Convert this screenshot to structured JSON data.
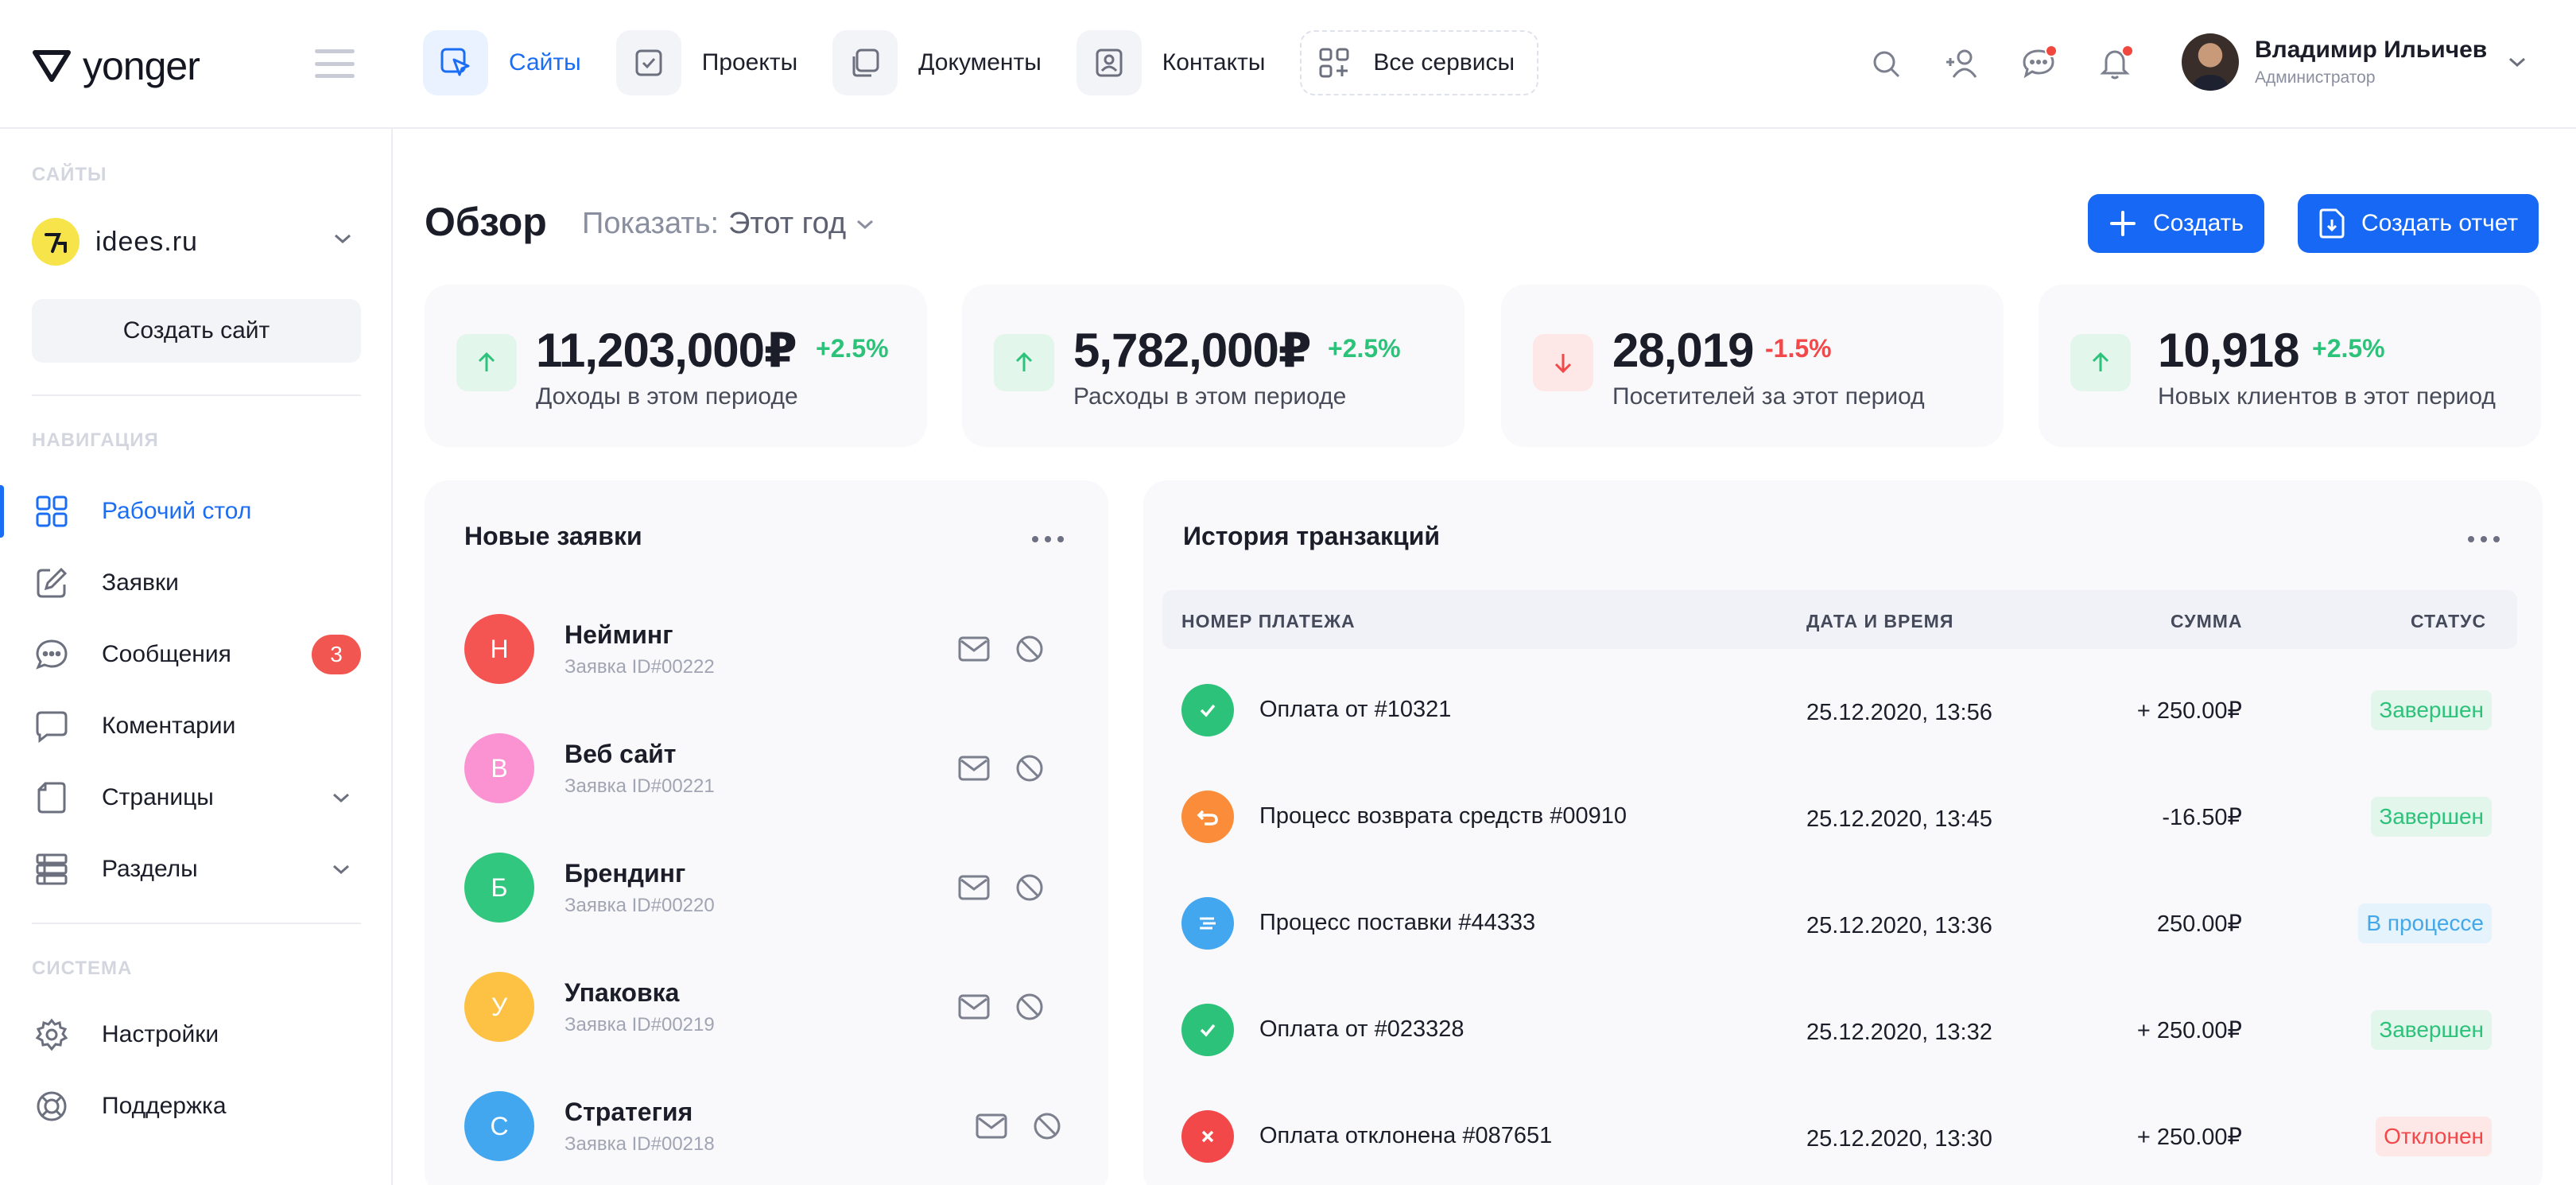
{
  "brand": {
    "name": "yonger"
  },
  "topnav": [
    {
      "label": "Сайты",
      "icon": "cursor-icon",
      "active": true
    },
    {
      "label": "Проекты",
      "icon": "checkbox-icon"
    },
    {
      "label": "Документы",
      "icon": "documents-icon"
    },
    {
      "label": "Контакты",
      "icon": "contact-card-icon"
    },
    {
      "label": "Все сервисы",
      "icon": "grid-plus-icon"
    }
  ],
  "user": {
    "name": "Владимир Ильичев",
    "role": "Администратор"
  },
  "sidebar": {
    "sites_title": "САЙТЫ",
    "site_name": "idees.ru",
    "create_site": "Создать сайт",
    "nav_title": "НАВИГАЦИЯ",
    "nav": [
      {
        "label": "Рабочий стол",
        "icon": "dashboard-icon",
        "active": true
      },
      {
        "label": "Заявки",
        "icon": "edit-icon"
      },
      {
        "label": "Сообщения",
        "icon": "chat-dots-icon",
        "badge": "3"
      },
      {
        "label": "Коментарии",
        "icon": "comment-icon"
      },
      {
        "label": "Страницы",
        "icon": "page-icon",
        "expandable": true
      },
      {
        "label": "Разделы",
        "icon": "sections-icon",
        "expandable": true
      }
    ],
    "system_title": "СИСТЕМА",
    "system": [
      {
        "label": "Настройки",
        "icon": "gear-icon"
      },
      {
        "label": "Поддержка",
        "icon": "lifebuoy-icon"
      }
    ]
  },
  "overview": {
    "title": "Обзор",
    "show_label": "Показать:",
    "show_value": "Этот год",
    "create_button": "Создать",
    "report_button": "Создать отчет"
  },
  "stats": [
    {
      "value": "11,203,000₽",
      "change": "+2.5%",
      "label": "Доходы в этом периоде",
      "trend": "up"
    },
    {
      "value": "5,782,000₽",
      "change": "+2.5%",
      "label": "Расходы в этом периоде",
      "trend": "up"
    },
    {
      "value": "28,019",
      "change": "-1.5%",
      "label": "Посетителей за этот период",
      "trend": "down"
    },
    {
      "value": "10,918",
      "change": "+2.5%",
      "label": "Новых клиентов в этот период",
      "trend": "up"
    }
  ],
  "requests": {
    "title": "Новые заявки",
    "items": [
      {
        "initial": "Н",
        "title": "Нейминг",
        "id": "Заявка ID#00222",
        "color": "#f55552"
      },
      {
        "initial": "В",
        "title": "Веб сайт",
        "id": "Заявка ID#00221",
        "color": "#fb93d3"
      },
      {
        "initial": "Б",
        "title": "Брендинг",
        "id": "Заявка ID#00220",
        "color": "#31c77e"
      },
      {
        "initial": "У",
        "title": "Упаковка",
        "id": "Заявка ID#00219",
        "color": "#fdc143"
      },
      {
        "initial": "С",
        "title": "Стратегия",
        "id": "Заявка ID#00218",
        "color": "#43a7f0"
      }
    ]
  },
  "transactions": {
    "title": "История транзакций",
    "headers": {
      "number": "НОМЕР ПЛАТЕЖА",
      "date": "ДАТА И ВРЕМЯ",
      "sum": "СУММА",
      "status": "СТАТУС"
    },
    "rows": [
      {
        "name": "Оплата от #10321",
        "date": "25.12.2020, 13:56",
        "sum": "+ 250.00₽",
        "status": "Завершен",
        "kind": "ok"
      },
      {
        "name": "Процесс возврата средств #00910",
        "date": "25.12.2020, 13:45",
        "sum": "-16.50₽",
        "status": "Завершен",
        "kind": "refund"
      },
      {
        "name": "Процесс поставки #44333",
        "date": "25.12.2020, 13:36",
        "sum": "250.00₽",
        "status": "В процессе",
        "kind": "delivery"
      },
      {
        "name": "Оплата от #023328",
        "date": "25.12.2020, 13:32",
        "sum": "+ 250.00₽",
        "status": "Завершен",
        "kind": "ok"
      },
      {
        "name": "Оплата отклонена #087651",
        "date": "25.12.2020, 13:30",
        "sum": "+ 250.00₽",
        "status": "Отклонен",
        "kind": "rejected"
      }
    ]
  },
  "colors": {
    "accent": "#1668f5",
    "success": "#2dc27a",
    "danger": "#f2484a",
    "info": "#43a7e8"
  }
}
